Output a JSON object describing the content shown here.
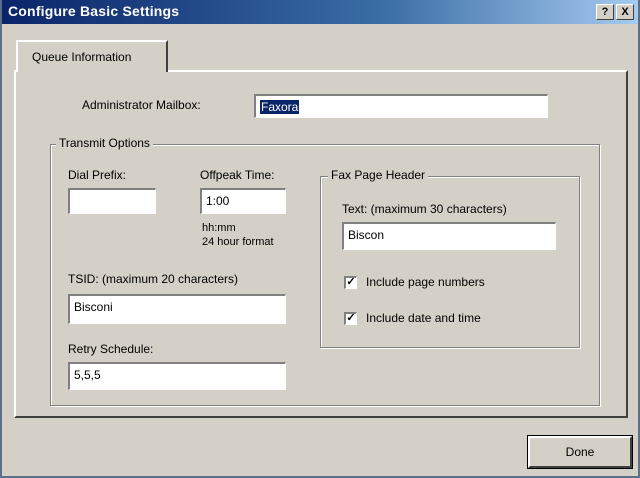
{
  "window": {
    "title": "Configure Basic Settings",
    "help_glyph": "?",
    "close_glyph": "X"
  },
  "tabs": [
    {
      "label": "Queue Information"
    }
  ],
  "admin": {
    "label": "Administrator Mailbox:",
    "value": "Faxora"
  },
  "transmit": {
    "label": "Transmit Options",
    "dial_prefix": {
      "label": "Dial Prefix:",
      "value": ""
    },
    "offpeak": {
      "label": "Offpeak Time:",
      "value": "1:00",
      "hint_line1": "hh:mm",
      "hint_line2": "24 hour format"
    },
    "tsid": {
      "label": "TSID: (maximum 20 characters)",
      "value": "Bisconi"
    },
    "retry": {
      "label": "Retry Schedule:",
      "value": "5,5,5"
    }
  },
  "fax_header": {
    "label": "Fax Page Header",
    "text_label": "Text: (maximum 30 characters)",
    "text_value": "Biscon",
    "include_page_numbers": {
      "label": "Include page numbers",
      "checked": true,
      "mark": "✓"
    },
    "include_date_time": {
      "label": "Include date and time",
      "checked": true,
      "mark": "✓"
    }
  },
  "buttons": {
    "done": "Done"
  }
}
